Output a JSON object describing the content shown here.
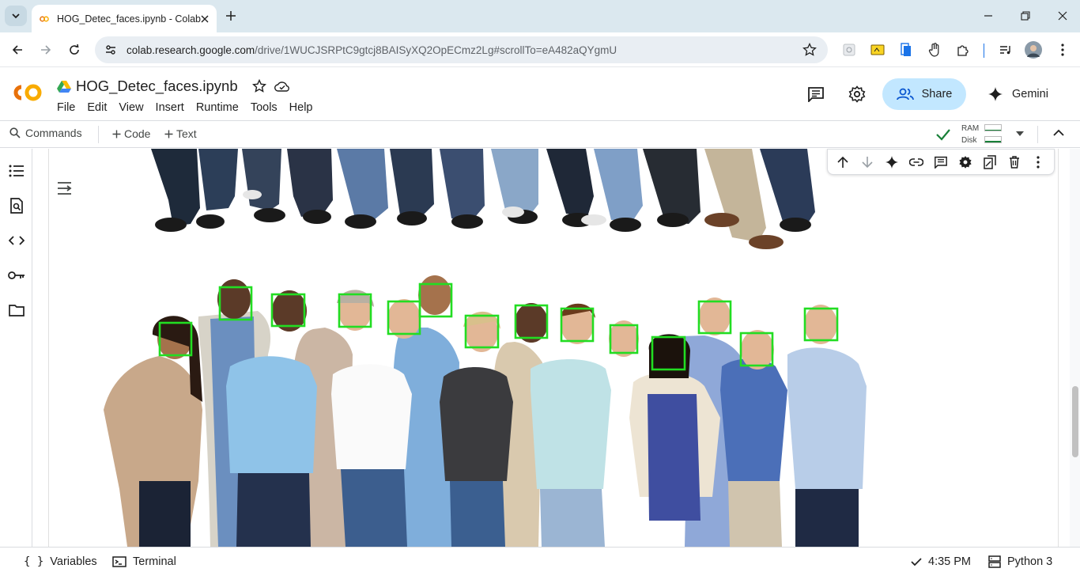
{
  "browser": {
    "tab_title": "HOG_Detec_faces.ipynb - Colab",
    "url_host": "colab.research.google.com",
    "url_path": "/drive/1WUCJSRPtC9gtcj8BAISyXQ2OpECmz2Lg#scrollTo=eA482aQYgmU"
  },
  "colab": {
    "notebook_title": "HOG_Detec_faces.ipynb",
    "menu": [
      "File",
      "Edit",
      "View",
      "Insert",
      "Runtime",
      "Tools",
      "Help"
    ],
    "share_label": "Share",
    "gemini_label": "Gemini"
  },
  "toolbar": {
    "commands_label": "Commands",
    "code_label": "Code",
    "text_label": "Text",
    "ram_label": "RAM",
    "disk_label": "Disk"
  },
  "output": {
    "image_description_faces_detected": 14
  },
  "statusbar": {
    "variables_label": "Variables",
    "terminal_label": "Terminal",
    "time_label": "4:35 PM",
    "runtime_label": "Python 3"
  },
  "colors": {
    "tabstrip": "#dbe8ef",
    "share_bg": "#c2e7ff",
    "detection_box": "#22dd22",
    "colab_orange": "#f9ab00",
    "colab_dark_orange": "#e8710a"
  }
}
